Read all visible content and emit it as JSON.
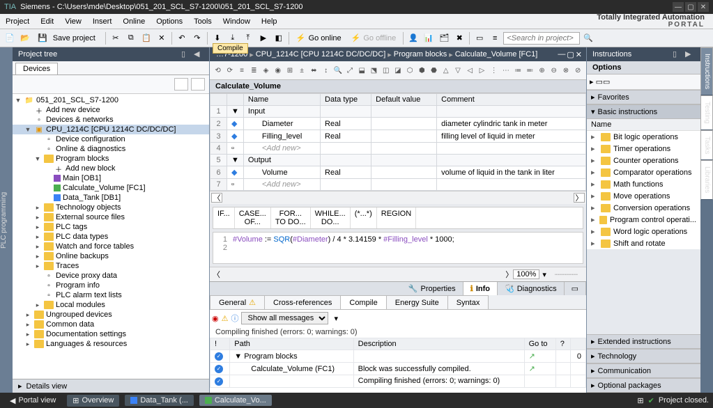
{
  "title_bar": {
    "text": "Siemens  -  C:\\Users\\mde\\Desktop\\051_201_SCL_S7-1200\\051_201_SCL_S7-1200"
  },
  "menu": {
    "items": [
      "Project",
      "Edit",
      "View",
      "Insert",
      "Online",
      "Options",
      "Tools",
      "Window",
      "Help"
    ],
    "brand_top": "Totally Integrated Automation",
    "brand_bottom": "PORTAL"
  },
  "toolbar": {
    "save_label": "Save project",
    "go_online": "Go online",
    "go_offline": "Go offline",
    "search_placeholder": "<Search in project>",
    "tooltip": "Compile"
  },
  "project_tree": {
    "title": "Project tree",
    "tabs": [
      "Devices"
    ],
    "nodes": [
      {
        "indent": 0,
        "exp": "▼",
        "icon": "project",
        "label": "051_201_SCL_S7-1200"
      },
      {
        "indent": 1,
        "exp": "",
        "icon": "add",
        "label": "Add new device"
      },
      {
        "indent": 1,
        "exp": "",
        "icon": "net",
        "label": "Devices & networks"
      },
      {
        "indent": 1,
        "exp": "▼",
        "icon": "cpu",
        "label": "CPU_1214C [CPU 1214C DC/DC/DC]",
        "selected": true
      },
      {
        "indent": 2,
        "exp": "",
        "icon": "cfg",
        "label": "Device configuration"
      },
      {
        "indent": 2,
        "exp": "",
        "icon": "diag",
        "label": "Online & diagnostics"
      },
      {
        "indent": 2,
        "exp": "▼",
        "icon": "folder",
        "label": "Program blocks"
      },
      {
        "indent": 3,
        "exp": "",
        "icon": "add",
        "label": "Add new block"
      },
      {
        "indent": 3,
        "exp": "",
        "icon": "ob",
        "label": "Main [OB1]"
      },
      {
        "indent": 3,
        "exp": "",
        "icon": "fc",
        "label": "Calculate_Volume [FC1]"
      },
      {
        "indent": 3,
        "exp": "",
        "icon": "db",
        "label": "Data_Tank [DB1]"
      },
      {
        "indent": 2,
        "exp": "▸",
        "icon": "folder",
        "label": "Technology objects"
      },
      {
        "indent": 2,
        "exp": "▸",
        "icon": "folder",
        "label": "External source files"
      },
      {
        "indent": 2,
        "exp": "▸",
        "icon": "folder",
        "label": "PLC tags"
      },
      {
        "indent": 2,
        "exp": "▸",
        "icon": "folder",
        "label": "PLC data types"
      },
      {
        "indent": 2,
        "exp": "▸",
        "icon": "folder",
        "label": "Watch and force tables"
      },
      {
        "indent": 2,
        "exp": "▸",
        "icon": "folder",
        "label": "Online backups"
      },
      {
        "indent": 2,
        "exp": "▸",
        "icon": "folder",
        "label": "Traces"
      },
      {
        "indent": 2,
        "exp": "",
        "icon": "file",
        "label": "Device proxy data"
      },
      {
        "indent": 2,
        "exp": "",
        "icon": "file",
        "label": "Program info"
      },
      {
        "indent": 2,
        "exp": "",
        "icon": "file",
        "label": "PLC alarm text lists"
      },
      {
        "indent": 2,
        "exp": "▸",
        "icon": "folder",
        "label": "Local modules"
      },
      {
        "indent": 1,
        "exp": "▸",
        "icon": "folder",
        "label": "Ungrouped devices"
      },
      {
        "indent": 1,
        "exp": "▸",
        "icon": "folder",
        "label": "Common data"
      },
      {
        "indent": 1,
        "exp": "▸",
        "icon": "folder",
        "label": "Documentation settings"
      },
      {
        "indent": 1,
        "exp": "▸",
        "icon": "folder",
        "label": "Languages & resources"
      }
    ],
    "details": "Details view"
  },
  "breadcrumb": {
    "parts": [
      "…7-1200",
      "CPU_1214C [CPU 1214C DC/DC/DC]",
      "Program blocks",
      "Calculate_Volume [FC1]"
    ]
  },
  "block_title": "Calculate_Volume",
  "interface": {
    "headers": [
      "",
      "",
      "Name",
      "Data type",
      "Default value",
      "Comment"
    ],
    "rows": [
      {
        "num": "1",
        "type": "sect",
        "name": "Input"
      },
      {
        "num": "2",
        "type": "var",
        "name": "Diameter",
        "dtype": "Real",
        "def": "",
        "comment": "diameter cylindric tank in meter"
      },
      {
        "num": "3",
        "type": "var",
        "name": "Filling_level",
        "dtype": "Real",
        "def": "",
        "comment": "filling level of liquid in meter"
      },
      {
        "num": "4",
        "type": "add",
        "name": "<Add new>"
      },
      {
        "num": "5",
        "type": "sect",
        "name": "Output"
      },
      {
        "num": "6",
        "type": "var",
        "name": "Volume",
        "dtype": "Real",
        "def": "",
        "comment": "volume of liquid in the tank in liter"
      },
      {
        "num": "7",
        "type": "add",
        "name": "<Add new>"
      }
    ]
  },
  "keywords": [
    {
      "l1": "IF..."
    },
    {
      "l1": "CASE...",
      "l2": "OF..."
    },
    {
      "l1": "FOR...",
      "l2": "TO DO..."
    },
    {
      "l1": "WHILE...",
      "l2": "DO..."
    },
    {
      "l1": "(*...*)"
    },
    {
      "l1": "REGION"
    }
  ],
  "code": {
    "lines": [
      {
        "ln": "1",
        "parts": [
          {
            "t": "#Volume",
            "c": "var"
          },
          {
            "t": " := "
          },
          {
            "t": "SQR",
            "c": "kw-tok"
          },
          {
            "t": "("
          },
          {
            "t": "#Diameter",
            "c": "var"
          },
          {
            "t": ") / 4 * 3.14159 * "
          },
          {
            "t": "#Filling_level",
            "c": "var"
          },
          {
            "t": " * 1000;"
          }
        ]
      },
      {
        "ln": "2",
        "parts": []
      }
    ]
  },
  "zoom": "100%",
  "info_tabs": {
    "items": [
      "Properties",
      "Info",
      "Diagnostics"
    ],
    "active": 1
  },
  "sub_tabs": {
    "items": [
      "General",
      "Cross-references",
      "Compile",
      "Energy Suite",
      "Syntax"
    ],
    "active": 2
  },
  "compile": {
    "filter": "Show all messages",
    "summary": "Compiling finished (errors: 0; warnings: 0)",
    "headers": [
      "!",
      "Path",
      "Description",
      "Go to",
      "?",
      ""
    ],
    "rows": [
      {
        "status": "ok",
        "indent": 0,
        "path": "▼  Program blocks",
        "desc": "",
        "goto": "↗",
        "q": "",
        "val": "0"
      },
      {
        "status": "ok",
        "indent": 1,
        "path": "Calculate_Volume (FC1)",
        "desc": "Block was successfully compiled.",
        "goto": "↗",
        "q": "",
        "val": ""
      },
      {
        "status": "ok",
        "indent": 1,
        "path": "",
        "desc": "Compiling finished (errors: 0; warnings: 0)",
        "goto": "",
        "q": "",
        "val": ""
      }
    ]
  },
  "instructions": {
    "title": "Instructions",
    "options": "Options",
    "sections": {
      "favorites": "Favorites",
      "basic": "Basic instructions",
      "extended": "Extended instructions",
      "technology": "Technology",
      "communication": "Communication",
      "optional": "Optional packages"
    },
    "name_header": "Name",
    "items": [
      "Bit logic operations",
      "Timer operations",
      "Counter operations",
      "Comparator operations",
      "Math functions",
      "Move operations",
      "Conversion operations",
      "Program control operati...",
      "Word logic operations",
      "Shift and rotate"
    ]
  },
  "side_tabs_left": "PLC programming",
  "side_tabs_right": [
    "Instructions",
    "Testing",
    "Tasks",
    "Libraries"
  ],
  "status_bar": {
    "portal": "Portal view",
    "overview": "Overview",
    "tabs": [
      "Data_Tank (...",
      "Calculate_Vo..."
    ],
    "project_closed": "Project closed."
  }
}
